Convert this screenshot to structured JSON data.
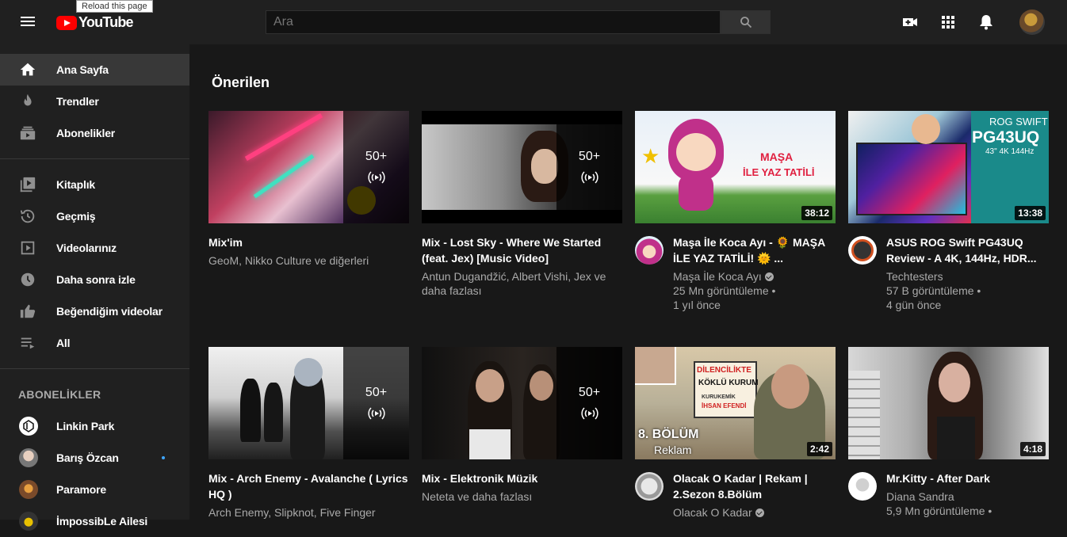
{
  "tooltip": "Reload this page",
  "logo_text": "YouTube",
  "search": {
    "placeholder": "Ara"
  },
  "sidebar": {
    "items": [
      {
        "label": "Ana Sayfa",
        "icon": "home-icon"
      },
      {
        "label": "Trendler",
        "icon": "fire-icon"
      },
      {
        "label": "Abonelikler",
        "icon": "subscriptions-icon"
      },
      {
        "label": "Kitaplık",
        "icon": "library-icon"
      },
      {
        "label": "Geçmiş",
        "icon": "history-icon"
      },
      {
        "label": "Videolarınız",
        "icon": "your-videos-icon"
      },
      {
        "label": "Daha sonra izle",
        "icon": "clock-icon"
      },
      {
        "label": "Beğendiğim videolar",
        "icon": "thumbs-up-icon"
      },
      {
        "label": "All",
        "icon": "playlist-icon"
      }
    ],
    "subscriptions_heading": "ABONELİKLER",
    "subscriptions": [
      {
        "label": "Linkin Park"
      },
      {
        "label": "Barış Özcan"
      },
      {
        "label": "Paramore"
      },
      {
        "label": "İmpossibLe Ailesi"
      }
    ]
  },
  "main": {
    "section_title": "Önerilen",
    "videos": [
      {
        "title": "Mix'im",
        "meta1": "GeoM, Nikko Culture ve diğerleri",
        "mix_count": "50+"
      },
      {
        "title": "Mix - Lost Sky - Where We Started (feat. Jex) [Music Video]",
        "meta1": "Antun Dugandžić, Albert Vishi, Jex ve daha fazlası",
        "mix_count": "50+"
      },
      {
        "title": "Maşa İle Koca Ayı - 🌻 MAŞA İLE YAZ TATİLİ! 🌞 ...",
        "channel": "Maşa İle Koca Ayı",
        "views": "25 Mn görüntüleme •",
        "age": "1 yıl önce",
        "duration": "38:12",
        "thumb_text1": "MAŞA",
        "thumb_text2": "İLE YAZ TATİLİ"
      },
      {
        "title": "ASUS ROG Swift PG43UQ Review - A 4K, 144Hz, HDR...",
        "channel": "Techtesters",
        "views": "57 B görüntüleme •",
        "age": "4 gün önce",
        "duration": "13:38",
        "thumb_text1": "ROG SWIFT",
        "thumb_text2": "PG43UQ",
        "thumb_text3": "43\" 4K 144Hz"
      },
      {
        "title": "Mix - Arch Enemy - Avalanche ( Lyrics HQ )",
        "meta1": "Arch Enemy, Slipknot, Five Finger",
        "mix_count": "50+"
      },
      {
        "title": "Mix - Elektronik Müzik",
        "meta1": "Neteta ve daha fazlası",
        "mix_count": "50+"
      },
      {
        "title": "Olacak O Kadar | Rekam | 2.Sezon 8.Bölüm",
        "channel": "Olacak O Kadar",
        "duration": "2:42",
        "thumb_text1": "DİLENCİLİKTE",
        "thumb_text2": "KÖKLÜ KURUM",
        "thumb_text3": "8. BÖLÜM",
        "thumb_text4": "Reklam",
        "thumb_text5": "KURUKEMİK",
        "thumb_text6": "İHSAN EFENDİ"
      },
      {
        "title": "Mr.Kitty - After Dark",
        "channel": "Diana Sandra",
        "views": "5,9 Mn görüntüleme •",
        "duration": "4:18"
      }
    ]
  },
  "colors": {
    "background": "#181818",
    "topbar": "#202020",
    "active": "#383838",
    "accent_red": "#ff0000",
    "notification_dot": "#3ea6ff"
  }
}
